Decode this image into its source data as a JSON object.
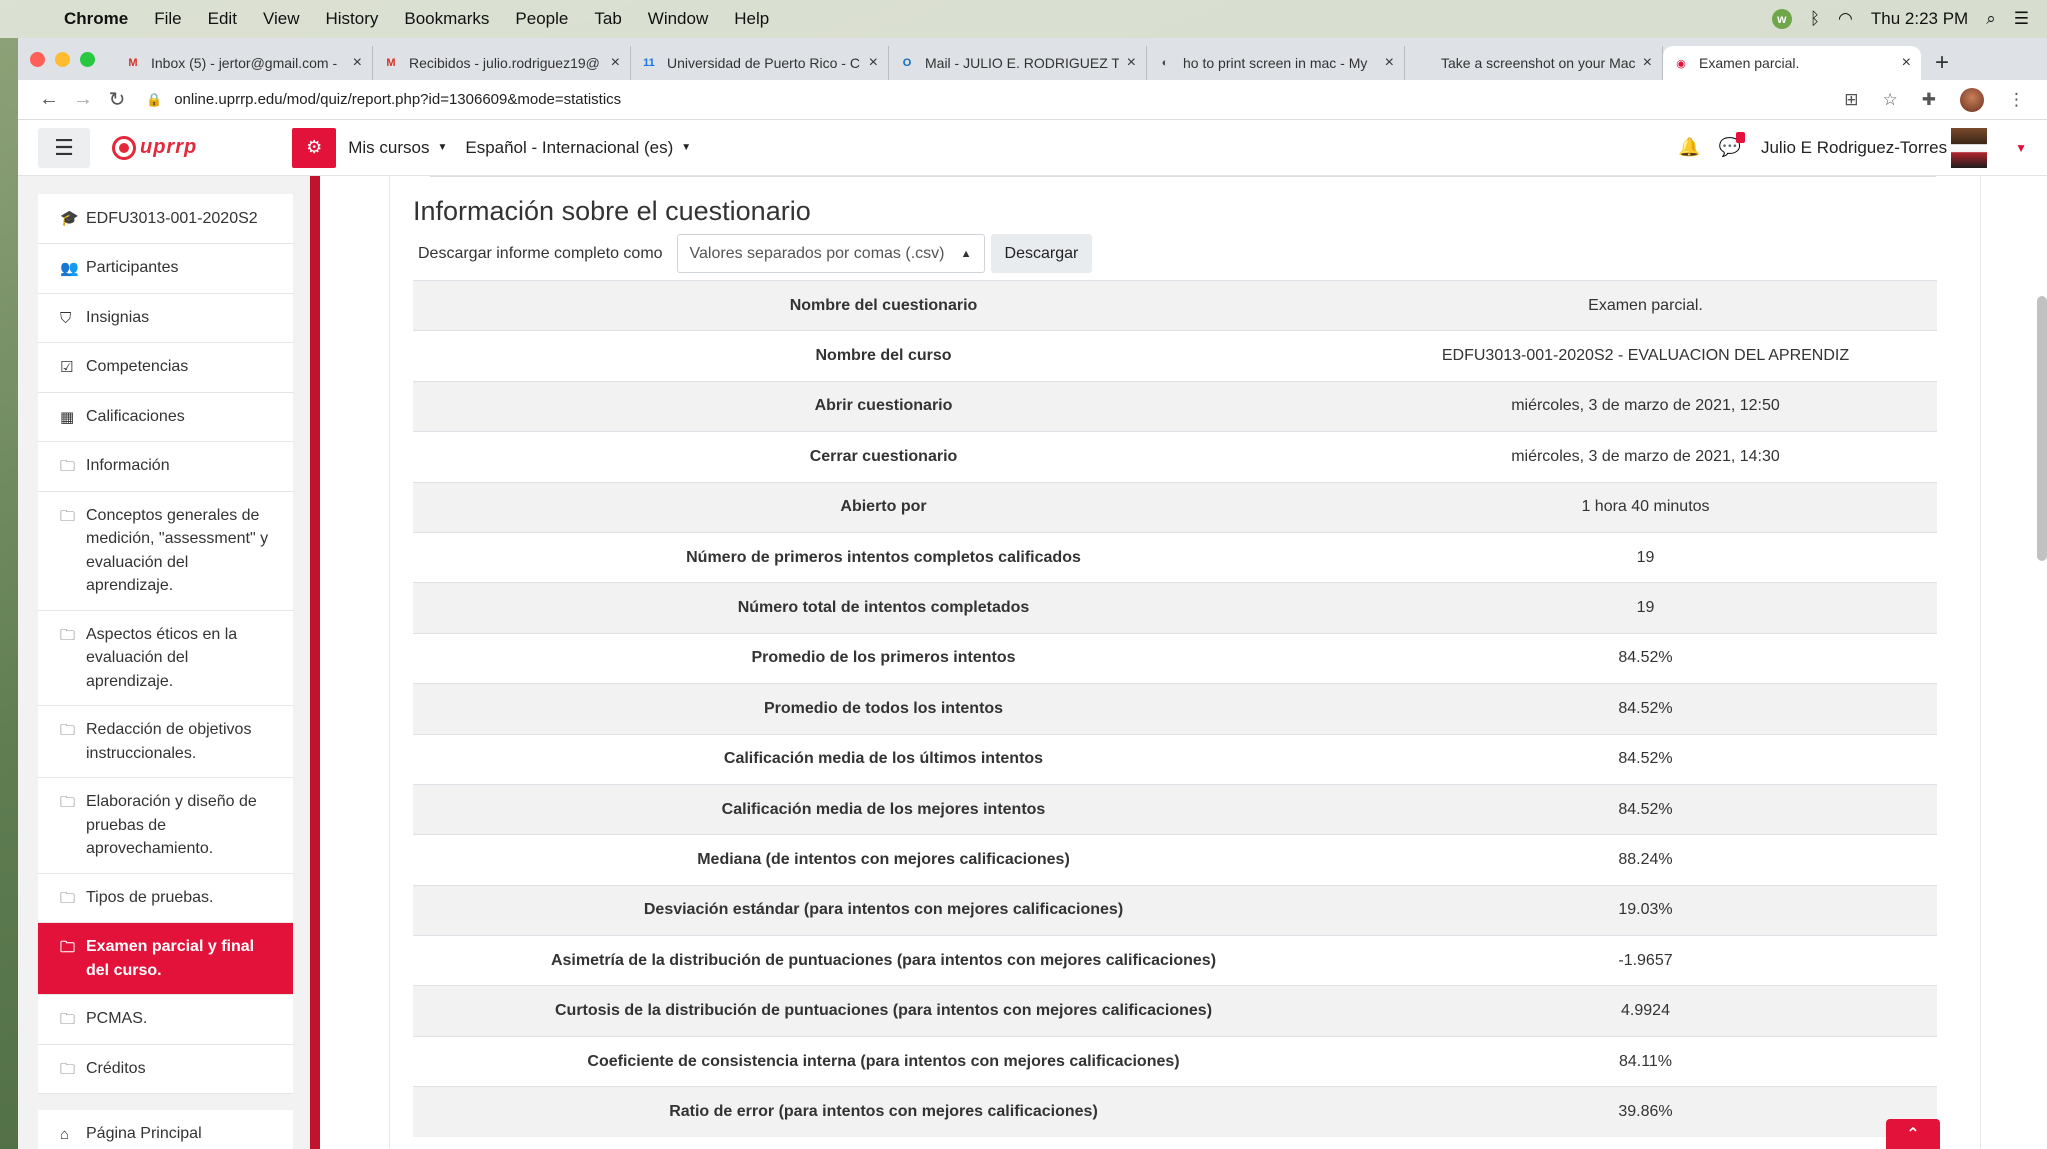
{
  "menubar": {
    "app": "Chrome",
    "items": [
      "File",
      "Edit",
      "View",
      "History",
      "Bookmarks",
      "People",
      "Tab",
      "Window",
      "Help"
    ],
    "clock": "Thu 2:23 PM"
  },
  "tabs": [
    {
      "title": "Inbox (5) - jertor@gmail.com -",
      "fav": "M",
      "favColor": "#d93025"
    },
    {
      "title": "Recibidos - julio.rodriguez19@",
      "fav": "M",
      "favColor": "#d93025"
    },
    {
      "title": "Universidad de Puerto Rico - C",
      "fav": "11",
      "favColor": "#1a73e8"
    },
    {
      "title": "Mail - JULIO E. RODRIGUEZ TO",
      "fav": "O",
      "favColor": "#0f6cbd"
    },
    {
      "title": "ho to print screen in mac - My",
      "fav": "◐",
      "favColor": "#444"
    },
    {
      "title": "Take a screenshot on your Mac",
      "fav": "",
      "favColor": "#999"
    },
    {
      "title": "Examen parcial.",
      "fav": "◉",
      "favColor": "#e3123a",
      "active": true
    }
  ],
  "address": {
    "url": "online.uprrp.edu/mod/quiz/report.php?id=1306609&mode=statistics"
  },
  "navbar": {
    "logo_text": "uprrp",
    "my_courses": "Mis cursos",
    "language": "Español - Internacional (es)",
    "user_name": "Julio E Rodriguez-Torres"
  },
  "drawer": {
    "items": [
      {
        "label": "EDFU3013-001-2020S2",
        "icon": "graduation-cap-icon",
        "glyph": "🎓"
      },
      {
        "label": "Participantes",
        "icon": "users-icon",
        "glyph": "👥"
      },
      {
        "label": "Insignias",
        "icon": "shield-icon",
        "glyph": "⛉"
      },
      {
        "label": "Competencias",
        "icon": "check-square-icon",
        "glyph": "☑"
      },
      {
        "label": "Calificaciones",
        "icon": "table-icon",
        "glyph": "▦"
      },
      {
        "label": "Información",
        "icon": "folder-icon",
        "glyph": "🗀"
      },
      {
        "label": "Conceptos generales de medición, \"assessment\" y evaluación del aprendizaje.",
        "icon": "folder-icon",
        "glyph": "🗀"
      },
      {
        "label": "Aspectos éticos en la evaluación del aprendizaje.",
        "icon": "folder-icon",
        "glyph": "🗀"
      },
      {
        "label": "Redacción de objetivos instruccionales.",
        "icon": "folder-icon",
        "glyph": "🗀"
      },
      {
        "label": "Elaboración y diseño de pruebas de aprovechamiento.",
        "icon": "folder-icon",
        "glyph": "🗀"
      },
      {
        "label": "Tipos de pruebas.",
        "icon": "folder-icon",
        "glyph": "🗀"
      },
      {
        "label": "Examen parcial y final del curso.",
        "icon": "folder-icon",
        "glyph": "🗀",
        "active": true
      },
      {
        "label": "PCMAS.",
        "icon": "folder-icon",
        "glyph": "🗀"
      },
      {
        "label": "Créditos",
        "icon": "folder-icon",
        "glyph": "🗀"
      }
    ],
    "home": {
      "label": "Página Principal",
      "icon": "home-icon",
      "glyph": "⌂"
    }
  },
  "main": {
    "heading": "Información sobre el cuestionario",
    "download_label": "Descargar informe completo como",
    "download_format": "Valores separados por comas (.csv)",
    "download_button": "Descargar",
    "rows": [
      {
        "k": "Nombre del cuestionario",
        "v": "Examen parcial."
      },
      {
        "k": "Nombre del curso",
        "v": "EDFU3013-001-2020S2 - EVALUACION DEL APRENDIZ"
      },
      {
        "k": "Abrir cuestionario",
        "v": "miércoles, 3 de marzo de 2021, 12:50"
      },
      {
        "k": "Cerrar cuestionario",
        "v": "miércoles, 3 de marzo de 2021, 14:30"
      },
      {
        "k": "Abierto por",
        "v": "1 hora 40 minutos"
      },
      {
        "k": "Número de primeros intentos completos calificados",
        "v": "19"
      },
      {
        "k": "Número total de intentos completados",
        "v": "19"
      },
      {
        "k": "Promedio de los primeros intentos",
        "v": "84.52%"
      },
      {
        "k": "Promedio de todos los intentos",
        "v": "84.52%"
      },
      {
        "k": "Calificación media de los últimos intentos",
        "v": "84.52%"
      },
      {
        "k": "Calificación media de los mejores intentos",
        "v": "84.52%"
      },
      {
        "k": "Mediana (de intentos con mejores calificaciones)",
        "v": "88.24%"
      },
      {
        "k": "Desviación estándar (para intentos con mejores calificaciones)",
        "v": "19.03%"
      },
      {
        "k": "Asimetría de la distribución de puntuaciones (para intentos con mejores calificaciones)",
        "v": "-1.9657"
      },
      {
        "k": "Curtosis de la distribución de puntuaciones (para intentos con mejores calificaciones)",
        "v": "4.9924"
      },
      {
        "k": "Coeficiente de consistencia interna (para intentos con mejores calificaciones)",
        "v": "84.11%"
      },
      {
        "k": "Ratio de error (para intentos con mejores calificaciones)",
        "v": "39.86%"
      }
    ]
  },
  "colors": {
    "accent": "#e3123a",
    "drawer_border": "#c0132d"
  }
}
